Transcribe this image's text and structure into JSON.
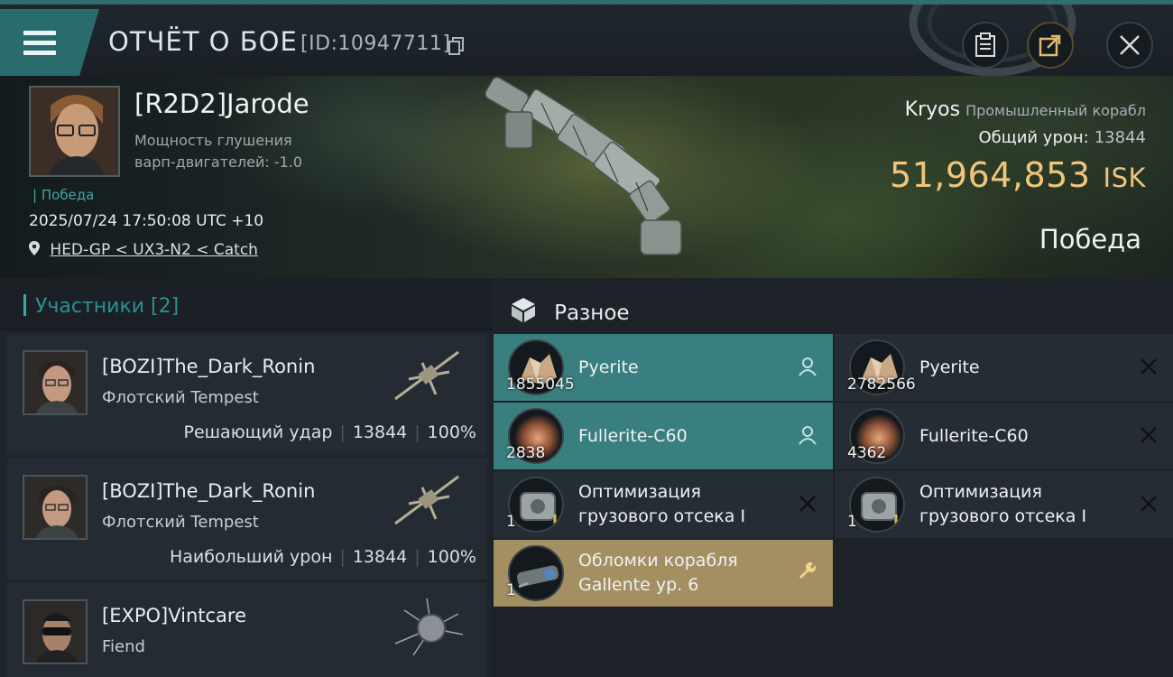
{
  "header": {
    "title": "ОТЧЁТ О БОЕ",
    "battle_id": "[ID:10947711]",
    "icons": [
      "menu-icon",
      "copy-icon",
      "clipboard-icon",
      "share-icon",
      "close-icon"
    ]
  },
  "victim": {
    "pilot_name": "[R2D2]Jarode",
    "attribute": "Мощность глушения варп-двигателей: -1.0",
    "tag": "Победа",
    "timestamp": "2025/07/24 17:50:08 UTC +10",
    "location": "HED-GP < UX3-N2 < Catch",
    "ship_name": "Kryos",
    "ship_class": "Промышленный корабл",
    "total_damage_label": "Общий урон:",
    "total_damage": "13844",
    "isk_value": "51,964,853",
    "isk_unit": "ISK",
    "result": "Победа"
  },
  "participants": {
    "header": "Участники [2]",
    "rows": [
      {
        "name": "[BOZI]The_Dark_Ronin",
        "ship": "Флотский Tempest",
        "role": "Решающий удар",
        "damage": "13844",
        "percent": "100%"
      },
      {
        "name": "[BOZI]The_Dark_Ronin",
        "ship": "Флотский Tempest",
        "role": "Наибольший урон",
        "damage": "13844",
        "percent": "100%"
      },
      {
        "name": "[EXPO]Vintcare",
        "ship": "Fiend",
        "role": "",
        "damage": "",
        "percent": ""
      }
    ]
  },
  "items": {
    "header": "Разное",
    "list": [
      {
        "name": "Pyerite",
        "qty": "1855045",
        "state": "dropped",
        "icon": "ore-icon",
        "action": "pilot-icon"
      },
      {
        "name": "Pyerite",
        "qty": "2782566",
        "state": "destroyed",
        "icon": "ore-icon",
        "action": "x-icon"
      },
      {
        "name": "Fullerite-C60",
        "qty": "2838",
        "state": "dropped",
        "icon": "gas-icon",
        "action": "pilot-icon"
      },
      {
        "name": "Fullerite-C60",
        "qty": "4362",
        "state": "destroyed",
        "icon": "gas-icon",
        "action": "x-icon"
      },
      {
        "name": "Оптимизация грузового отсека I",
        "qty": "1",
        "state": "destroyed",
        "icon": "rig-icon",
        "action": "x-icon"
      },
      {
        "name": "Оптимизация грузового отсека I",
        "qty": "1",
        "state": "destroyed",
        "icon": "rig-icon",
        "action": "x-icon"
      },
      {
        "name": "Обломки корабля Gallente ур. 6",
        "qty": "1",
        "state": "loot",
        "icon": "wreck-icon",
        "action": "wrench-icon"
      }
    ]
  },
  "colors": {
    "accent_teal": "#3a7f7f",
    "isk_gold": "#f0c57a",
    "loot_gold": "#a48f63"
  }
}
